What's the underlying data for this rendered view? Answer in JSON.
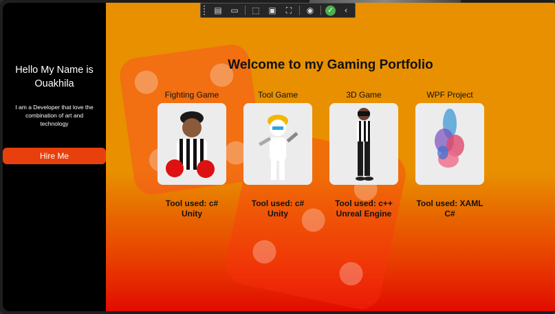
{
  "sidebar": {
    "greeting": "Hello My Name is Ouakhila",
    "tagline": "I am a Developer that love the combination of art and technology",
    "hire_label": "Hire Me"
  },
  "main": {
    "title": "Welcome to my Gaming Portfolio",
    "projects": [
      {
        "title": "Fighting Game",
        "tools_line1": "Tool used: c#",
        "tools_line2": "Unity",
        "image": "boxer-referee-character"
      },
      {
        "title": "Tool Game",
        "tools_line1": "Tool used: c#",
        "tools_line2": "Unity",
        "image": "builder-robot-character"
      },
      {
        "title": "3D Game",
        "tools_line1": "Tool used: c++",
        "tools_line2": "Unreal Engine",
        "image": "vr-referee-character"
      },
      {
        "title": "WPF Project",
        "tools_line1": "Tool used: XAML",
        "tools_line2": "C#",
        "image": "abstract-paint-smoke"
      }
    ]
  },
  "debug_toolbar": {
    "icons": [
      "live-visual-tree-icon",
      "record-icon",
      "select-element-icon",
      "display-layout-adorners-icon",
      "track-focus-icon",
      "binding-failures-icon",
      "ok-status-icon",
      "collapse-chevron-icon"
    ]
  },
  "colors": {
    "sidebar": "#000000",
    "accent_button": "#e8400c",
    "main_top": "#e89000",
    "main_bottom": "#e00c00"
  }
}
